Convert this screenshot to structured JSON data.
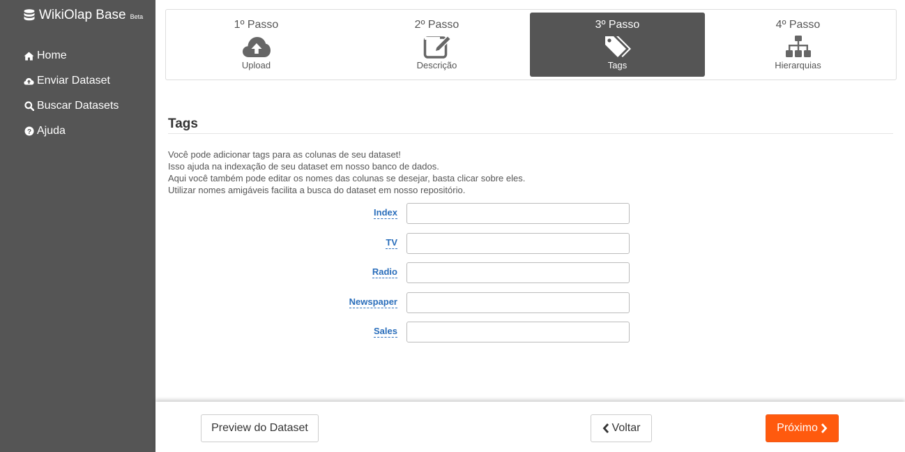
{
  "sidebar": {
    "brand": {
      "title": "WikiOlap Base",
      "badge": "Beta",
      "icon": "database-icon"
    },
    "items": [
      {
        "label": "Home",
        "icon": "home-icon"
      },
      {
        "label": "Enviar Dataset",
        "icon": "cloud-upload-icon"
      },
      {
        "label": "Buscar Datasets",
        "icon": "search-icon"
      },
      {
        "label": "Ajuda",
        "icon": "question-circle-icon"
      }
    ]
  },
  "steps": [
    {
      "title": "1º Passo",
      "label": "Upload",
      "icon": "cloud-upload-icon",
      "active": false
    },
    {
      "title": "2º Passo",
      "label": "Descrição",
      "icon": "edit-icon",
      "active": false
    },
    {
      "title": "3º Passo",
      "label": "Tags",
      "icon": "tags-icon",
      "active": true
    },
    {
      "title": "4º Passo",
      "label": "Hierarquias",
      "icon": "sitemap-icon",
      "active": false
    }
  ],
  "main": {
    "title": "Tags",
    "description": [
      "Você pode adicionar tags para as colunas de seu dataset!",
      "Isso ajuda na indexação de seu dataset em nosso banco de dados.",
      "Aqui você também pode editar os nomes das colunas se desejar, basta clicar sobre eles.",
      "Utilizar nomes amigáveis facilita a busca do dataset em nosso repositório."
    ],
    "columns": [
      {
        "name": "Index",
        "value": ""
      },
      {
        "name": "TV",
        "value": ""
      },
      {
        "name": "Radio",
        "value": ""
      },
      {
        "name": "Newspaper",
        "value": ""
      },
      {
        "name": "Sales",
        "value": ""
      }
    ]
  },
  "footer": {
    "preview_label": "Preview do Dataset",
    "back_label": "Voltar",
    "next_label": "Próximo"
  },
  "colors": {
    "sidebar_bg": "#555555",
    "active_step_bg": "#555555",
    "link": "#2a6ebb",
    "primary_button": "#ff5a0e"
  }
}
